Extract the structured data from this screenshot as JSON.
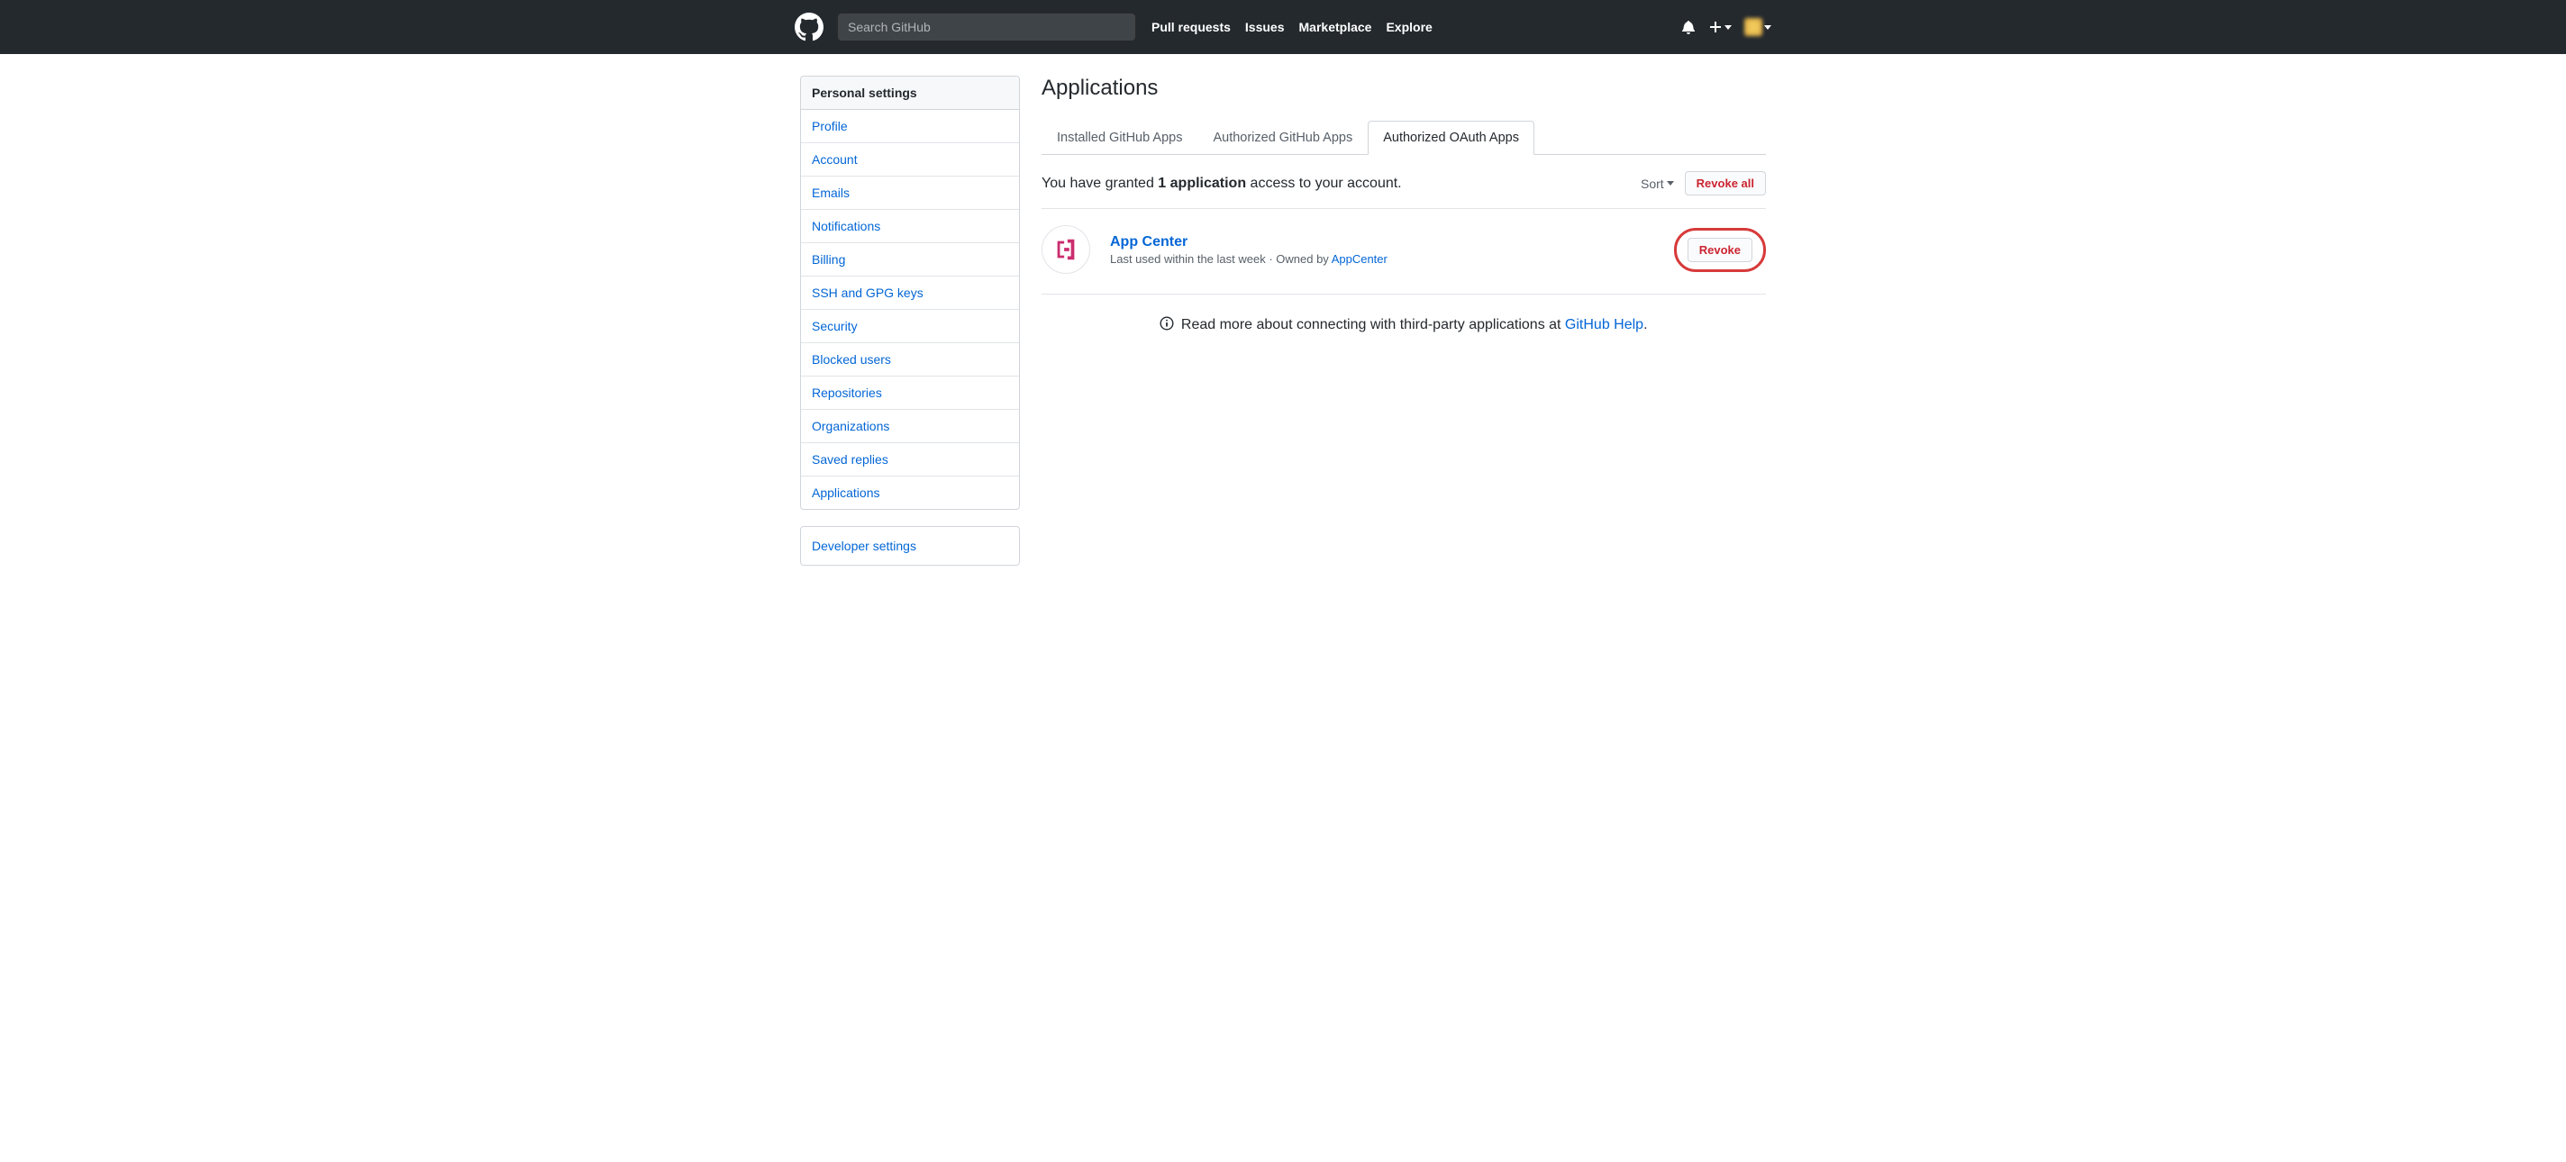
{
  "header": {
    "search_placeholder": "Search GitHub",
    "nav": {
      "pull_requests": "Pull requests",
      "issues": "Issues",
      "marketplace": "Marketplace",
      "explore": "Explore"
    }
  },
  "sidebar": {
    "header": "Personal settings",
    "items": [
      "Profile",
      "Account",
      "Emails",
      "Notifications",
      "Billing",
      "SSH and GPG keys",
      "Security",
      "Blocked users",
      "Repositories",
      "Organizations",
      "Saved replies",
      "Applications"
    ],
    "developer": "Developer settings"
  },
  "main": {
    "title": "Applications",
    "tabs": {
      "installed": "Installed GitHub Apps",
      "authorized_apps": "Authorized GitHub Apps",
      "authorized_oauth": "Authorized OAuth Apps"
    },
    "grant_text_pre": "You have granted ",
    "grant_count_label": "1 application",
    "grant_text_post": " access to your account.",
    "sort_label": "Sort",
    "revoke_all": "Revoke all",
    "app": {
      "name": "App Center",
      "last_used": "Last used within the last week",
      "owned_by_prefix": " · Owned by ",
      "owner": "AppCenter",
      "revoke": "Revoke"
    },
    "footer": {
      "text": "Read more about connecting with third-party applications at ",
      "link": "GitHub Help",
      "period": "."
    }
  }
}
